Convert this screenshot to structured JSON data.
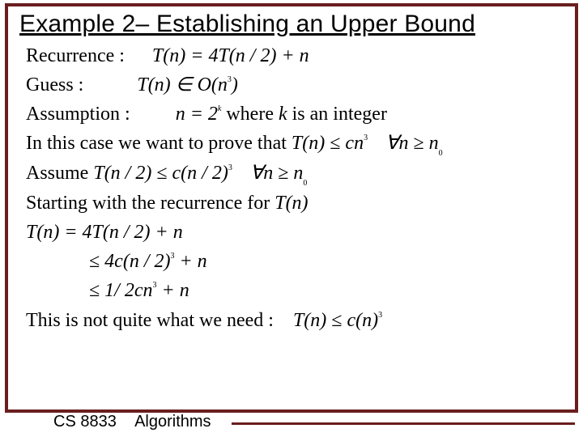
{
  "title": "Example 2– Establishing an Upper Bound",
  "lines": {
    "l1a": "Recurrence :",
    "l1b": "T",
    "l1c": "(n) = 4T(n / 2) + n",
    "l2a": "Guess :",
    "l2b": "T(n) ∈ O(n",
    "l2c": ")",
    "l3a": "Assumption :",
    "l3b": "n = 2",
    "l3c": " where ",
    "l3d": "k",
    "l3e": " is an integer",
    "l4a": "In this case we want to prove that ",
    "l4b": "T(n) ≤ cn",
    "l4c": "∀n ≥ n",
    "l5a": "Assume ",
    "l5b": "T(n / 2) ≤ c(n / 2)",
    "l5c": "∀n ≥ n",
    "l6a": "Starting with the recurrence for ",
    "l6b": "T(n)",
    "l7a": "T(n) = 4T(n / 2) + n",
    "l8a": "≤ 4c(n / 2)",
    "l8b": " + n",
    "l9a": "≤ 1/ 2cn",
    "l9b": " + n",
    "l10a": "This is not quite what we need :",
    "l10b": "T(n) ≤ c(n)",
    "sup3": "3",
    "supk": "k",
    "sub0": "0"
  },
  "footer": {
    "course": "CS 8833",
    "label": "Algorithms"
  }
}
